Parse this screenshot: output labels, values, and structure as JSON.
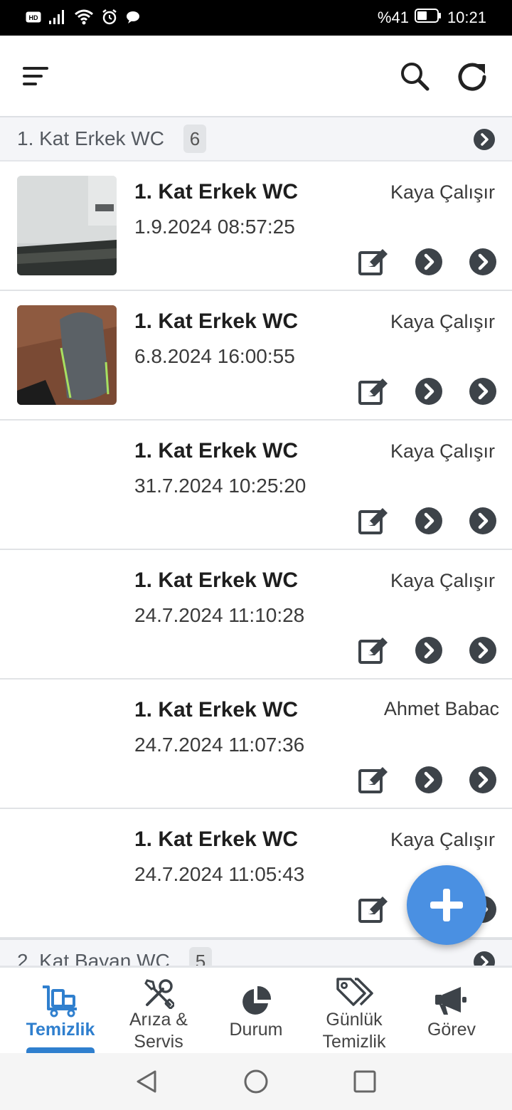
{
  "status_bar": {
    "battery_percent": "%41",
    "time": "10:21",
    "icons": [
      "hd-icon",
      "signal-icon",
      "wifi-icon",
      "alarm-icon",
      "chat-bubble-icon",
      "battery-icon"
    ]
  },
  "app_bar": {
    "icons": [
      "menu-icon",
      "search-icon",
      "refresh-icon"
    ]
  },
  "groups": [
    {
      "title": "1. Kat Erkek WC",
      "count": "6"
    },
    {
      "title": "2. Kat Bayan WC",
      "count": "5"
    }
  ],
  "entries": [
    {
      "title": "1. Kat Erkek WC",
      "date": "1.9.2024 08:57:25",
      "user": "Kaya Çalışır",
      "has_photo": true
    },
    {
      "title": "1. Kat Erkek WC",
      "date": "6.8.2024 16:00:55",
      "user": "Kaya Çalışır",
      "has_photo": true
    },
    {
      "title": "1. Kat Erkek WC",
      "date": "31.7.2024 10:25:20",
      "user": "Kaya Çalışır",
      "has_photo": false
    },
    {
      "title": "1. Kat Erkek WC",
      "date": "24.7.2024 11:10:28",
      "user": "Kaya Çalışır",
      "has_photo": false
    },
    {
      "title": "1. Kat Erkek WC",
      "date": "24.7.2024 11:07:36",
      "user": "Ahmet Babac",
      "has_photo": false
    },
    {
      "title": "1. Kat Erkek WC",
      "date": "24.7.2024 11:05:43",
      "user": "Kaya Çalışır",
      "has_photo": false
    }
  ],
  "tabs": [
    {
      "label": "Temizlik",
      "icon": "cleaning-cart-icon",
      "active": true
    },
    {
      "label_line1": "Arıza &",
      "label_line2": "Servis",
      "icon": "tools-icon",
      "active": false
    },
    {
      "label": "Durum",
      "icon": "pie-chart-icon",
      "active": false
    },
    {
      "label_line1": "Günlük",
      "label_line2": "Temizlik",
      "icon": "tags-icon",
      "active": false
    },
    {
      "label": "Görev",
      "icon": "megaphone-icon",
      "active": false
    }
  ],
  "colors": {
    "accent": "#2f7fce",
    "fab": "#4a90e2",
    "group_header_bg": "#f4f5f8",
    "icon_dark": "#3d4349"
  }
}
